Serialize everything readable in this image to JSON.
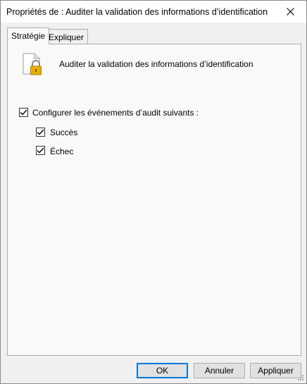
{
  "window": {
    "title": "Propriétés de : Auditer la validation des informations d’identification",
    "close_icon": "close-icon"
  },
  "tabs": [
    {
      "label": "Stratégie",
      "active": true
    },
    {
      "label": "Expliquer",
      "active": false
    }
  ],
  "policy": {
    "icon": "document-lock-icon",
    "name": "Auditer la validation des informations d’identification"
  },
  "configure": {
    "label": "Configurer les événements d’audit suivants :",
    "checked": true,
    "options": [
      {
        "label": "Succès",
        "checked": true
      },
      {
        "label": "Échec",
        "checked": true
      }
    ]
  },
  "buttons": {
    "ok": "OK",
    "cancel": "Annuler",
    "apply": "Appliquer"
  },
  "colors": {
    "accent": "#0078d7",
    "panel": "#f9f9f9",
    "window": "#f0f0f0",
    "lock": "#e8b000"
  }
}
